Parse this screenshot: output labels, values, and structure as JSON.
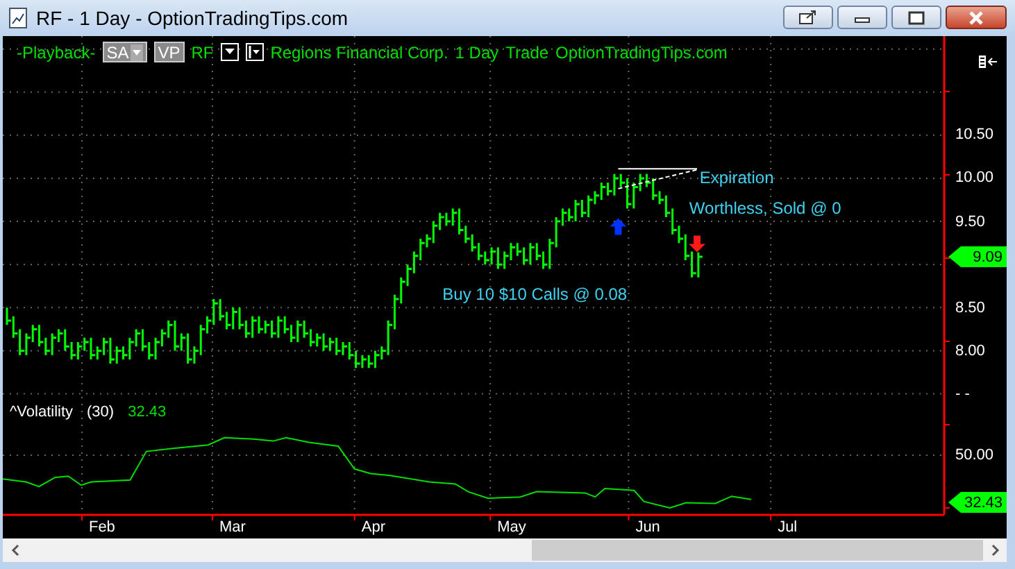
{
  "window": {
    "title": "RF - 1 Day - OptionTradingTips.com"
  },
  "toolbar": {
    "playback": "-Playback-",
    "buttons": [
      {
        "label": "SA",
        "dropdown": true
      },
      {
        "label": "VP",
        "dropdown": false
      }
    ],
    "symbol": "RF",
    "description": "Regions Financial Corp.",
    "interval": "1 Day",
    "mode": "Trade",
    "site": "OptionTradingTips.com"
  },
  "price_chart": {
    "kind": "bars",
    "axis_labels": [
      "10.50",
      "10.00",
      "9.50",
      "8.50",
      "8.00",
      "- -"
    ],
    "notes": [
      "Buy 10 $10 Calls @ 0.08",
      "Expiration",
      "Worthless, Sold @ 0"
    ],
    "markers": [
      {
        "kind": "buy_arrow"
      },
      {
        "kind": "sell_arrow"
      },
      {
        "kind": "solid_line"
      },
      {
        "kind": "dashed_line"
      }
    ],
    "price_tag": "9.09"
  },
  "volatility": {
    "name": "^Volatility",
    "period": "(30)",
    "value": "32.43",
    "axis_label": "50.00",
    "tag": "32.43"
  },
  "time_axis": {
    "labels": [
      "Feb",
      "Mar",
      "Apr",
      "May",
      "Jun",
      "Jul"
    ]
  }
}
